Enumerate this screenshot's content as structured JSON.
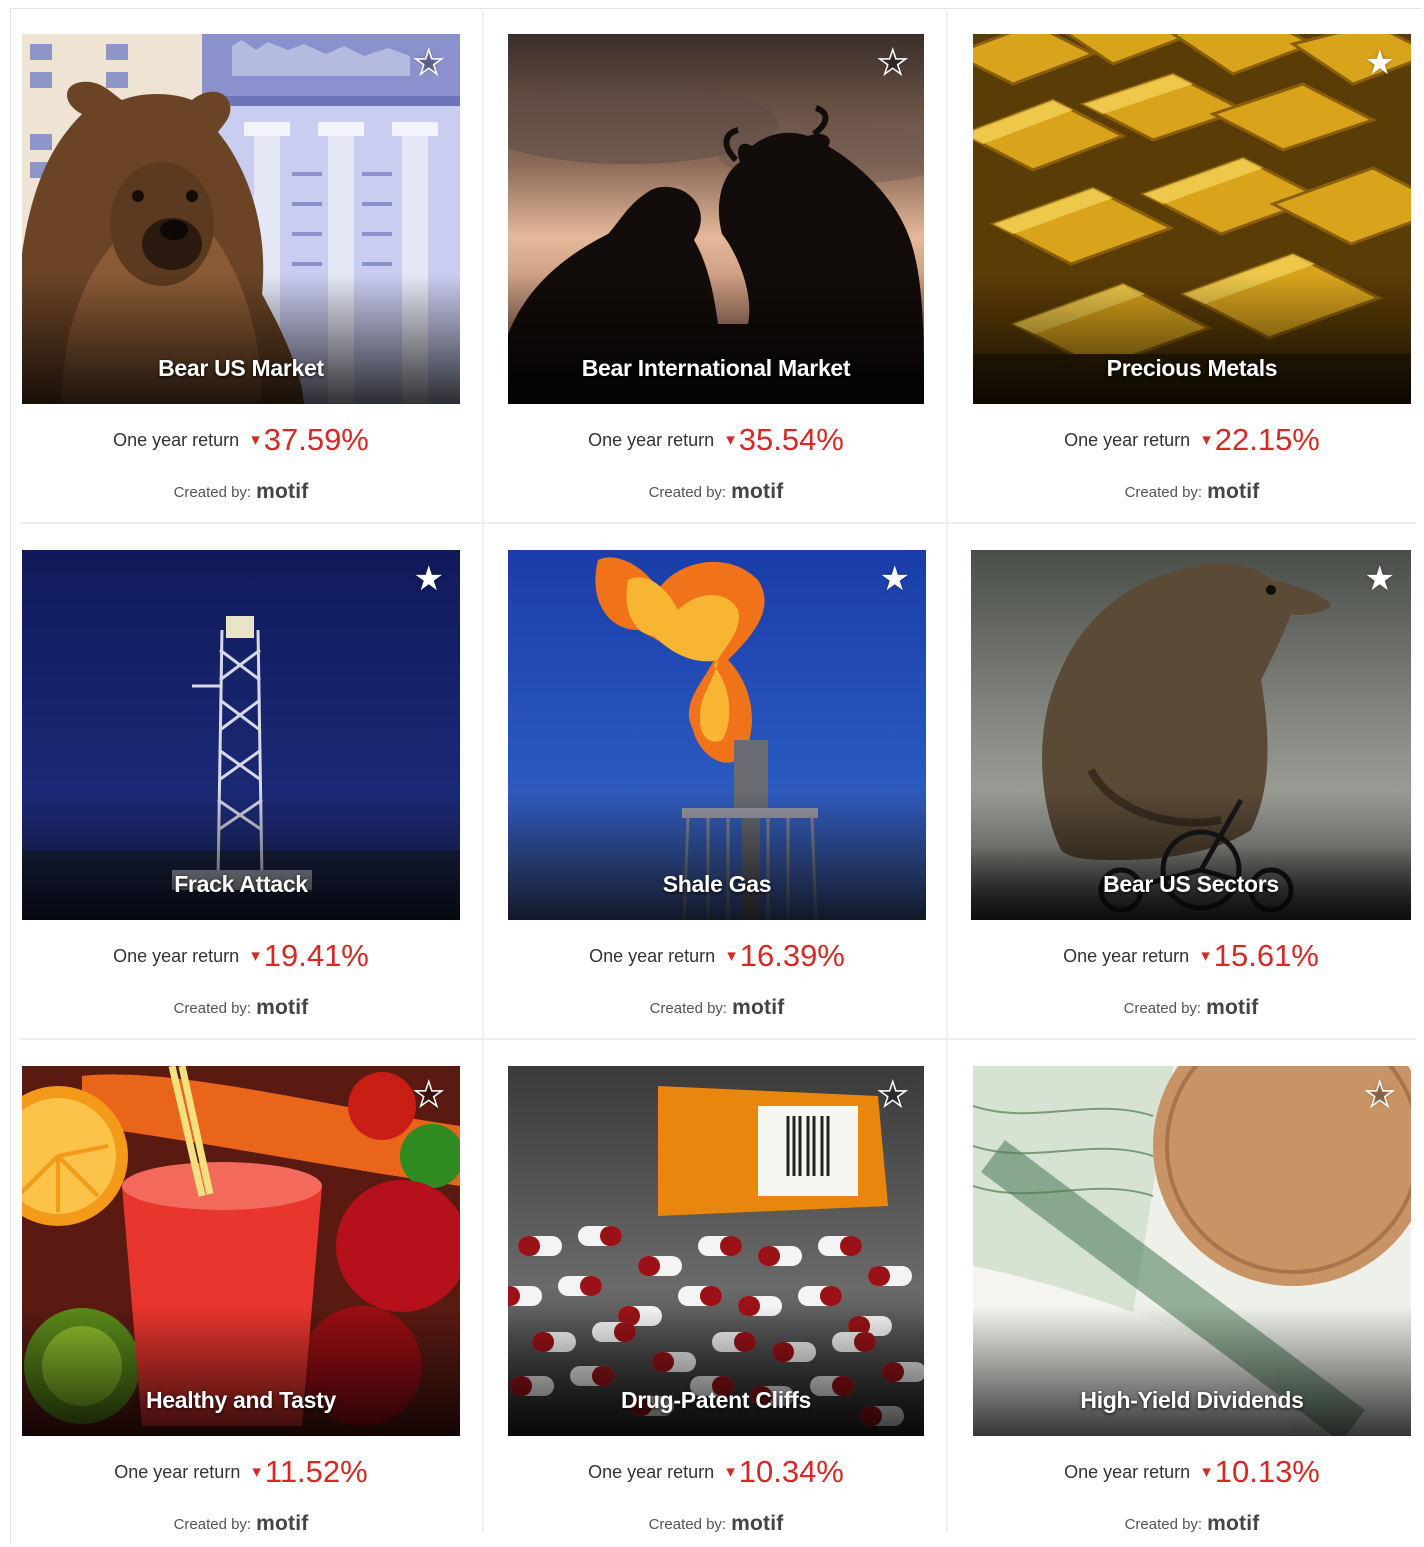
{
  "return_label": "One year return",
  "created_by_label": "Created by:",
  "brand": "motif",
  "down_arrow": "▾",
  "colors": {
    "negative": "#d42a25",
    "text": "#333333"
  },
  "cards": [
    {
      "title": "Bear US Market",
      "return": "37.59%",
      "star": "outline",
      "image": "bear-wall-street"
    },
    {
      "title": "Bear International Market",
      "return": "35.54%",
      "star": "outline",
      "image": "bear-bull-silhouette"
    },
    {
      "title": "Precious Metals",
      "return": "22.15%",
      "star": "solid",
      "image": "gold-bars"
    },
    {
      "title": "Frack Attack",
      "return": "19.41%",
      "star": "solid",
      "image": "drilling-rig"
    },
    {
      "title": "Shale Gas",
      "return": "16.39%",
      "star": "solid",
      "image": "gas-flare"
    },
    {
      "title": "Bear US Sectors",
      "return": "15.61%",
      "star": "solid",
      "image": "bear-on-tricycle"
    },
    {
      "title": "Healthy and Tasty",
      "return": "11.52%",
      "star": "outline",
      "image": "smoothie-fruits"
    },
    {
      "title": "Drug-Patent Cliffs",
      "return": "10.34%",
      "star": "outline",
      "image": "pills-bottle"
    },
    {
      "title": "High-Yield Dividends",
      "return": "10.13%",
      "star": "outline",
      "image": "share-certificate-coin"
    }
  ]
}
